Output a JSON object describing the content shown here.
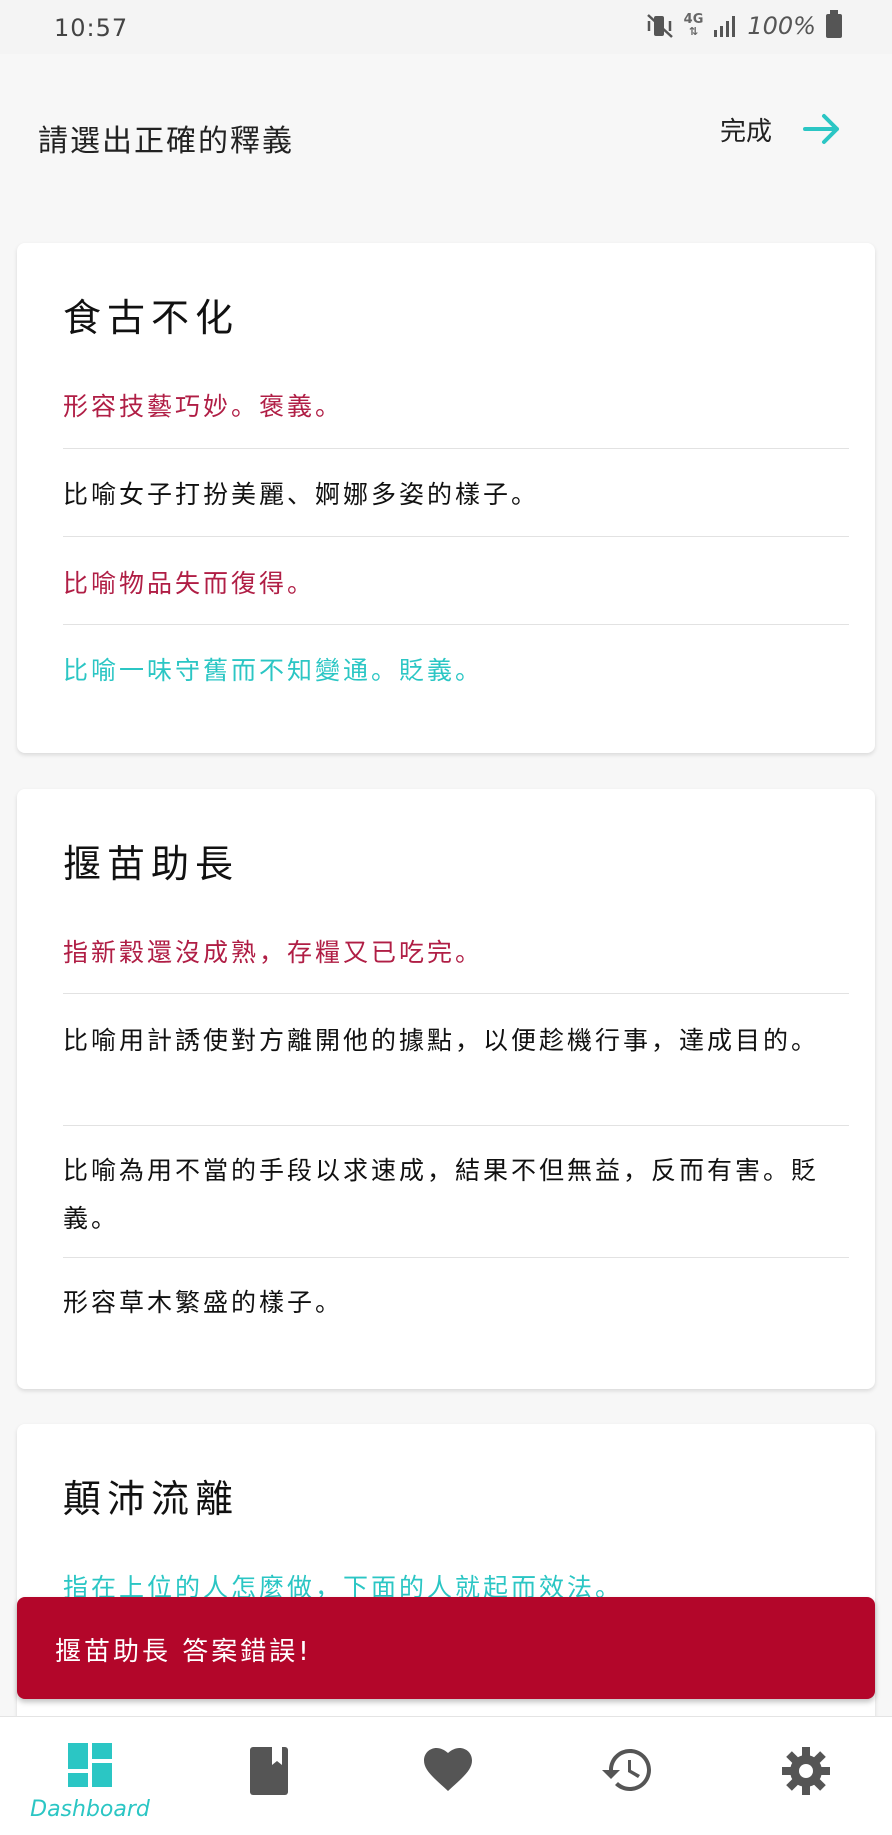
{
  "status_bar": {
    "time": "10:57",
    "network": "4G",
    "battery": "100%"
  },
  "header": {
    "title": "請選出正確的釋義",
    "done_label": "完成"
  },
  "questions": [
    {
      "idiom": "食古不化",
      "options": [
        {
          "text": "形容技藝巧妙。褒義。",
          "state": "wrong"
        },
        {
          "text": "比喻女子打扮美麗、婀娜多姿的樣子。",
          "state": "normal"
        },
        {
          "text": "比喻物品失而復得。",
          "state": "wrong"
        },
        {
          "text": "比喻一味守舊而不知變通。貶義。",
          "state": "correct"
        }
      ]
    },
    {
      "idiom": "揠苗助長",
      "options": [
        {
          "text": "指新穀還沒成熟，存糧又已吃完。",
          "state": "wrong"
        },
        {
          "text": "比喻用計誘使對方離開他的據點，以便趁機行事，達成目的。",
          "state": "normal"
        },
        {
          "text": "比喻為用不當的手段以求速成，結果不但無益，反而有害。貶義。",
          "state": "normal"
        },
        {
          "text": "形容草木繁盛的樣子。",
          "state": "normal"
        }
      ]
    },
    {
      "idiom": "顛沛流離",
      "options": [
        {
          "text": "指在上位的人怎麼做，下面的人就起而效法。",
          "state": "correct"
        }
      ]
    }
  ],
  "toast": {
    "message": "揠苗助長 答案錯誤!"
  },
  "bottom_nav": {
    "items": [
      {
        "label": "Dashboard",
        "icon": "dashboard-icon",
        "active": true
      },
      {
        "label": "",
        "icon": "book-icon",
        "active": false
      },
      {
        "label": "",
        "icon": "heart-icon",
        "active": false
      },
      {
        "label": "",
        "icon": "history-icon",
        "active": false
      },
      {
        "label": "",
        "icon": "gear-icon",
        "active": false
      }
    ]
  },
  "colors": {
    "accent": "#2bc6c4",
    "wrong": "#b01e45",
    "toast": "#b3062a",
    "icon_gray": "#555555"
  }
}
